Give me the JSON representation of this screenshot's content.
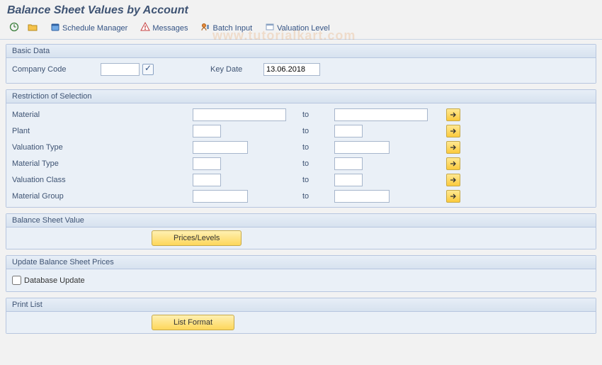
{
  "title": "Balance Sheet Values by Account",
  "toolbar": {
    "schedule_manager": "Schedule Manager",
    "messages": "Messages",
    "batch_input": "Batch Input",
    "valuation_level": "Valuation Level"
  },
  "groups": {
    "basic_data": {
      "title": "Basic Data",
      "company_code_label": "Company Code",
      "company_code_value": "",
      "key_date_label": "Key Date",
      "key_date_value": "13.06.2018"
    },
    "restriction": {
      "title": "Restriction of Selection",
      "to_label": "to",
      "rows": [
        {
          "label": "Material",
          "from": "",
          "to": ""
        },
        {
          "label": "Plant",
          "from": "",
          "to": ""
        },
        {
          "label": "Valuation Type",
          "from": "",
          "to": ""
        },
        {
          "label": "Material Type",
          "from": "",
          "to": ""
        },
        {
          "label": "Valuation Class",
          "from": "",
          "to": ""
        },
        {
          "label": "Material Group",
          "from": "",
          "to": ""
        }
      ]
    },
    "balance_sheet_value": {
      "title": "Balance Sheet Value",
      "button": "Prices/Levels"
    },
    "update_prices": {
      "title": "Update Balance Sheet Prices",
      "checkbox_label": "Database Update",
      "checked": false
    },
    "print_list": {
      "title": "Print List",
      "button": "List Format"
    }
  },
  "watermark": "www.tutorialkart.com"
}
